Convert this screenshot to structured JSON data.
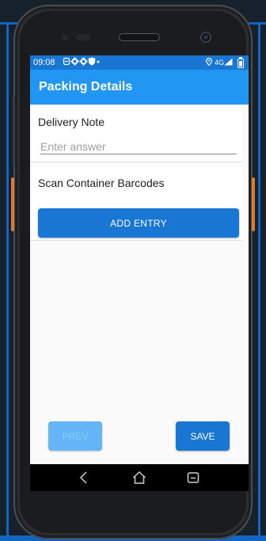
{
  "status_bar": {
    "time": "09:08",
    "left_icons": [
      "sync-icon",
      "gear-icon",
      "gear-icon",
      "shield-icon",
      "dot-icon"
    ],
    "network": "4G",
    "right_icons": [
      "location-icon",
      "signal-icon",
      "battery-icon"
    ]
  },
  "app_bar": {
    "title": "Packing Details"
  },
  "form": {
    "delivery_note": {
      "label": "Delivery Note",
      "placeholder": "Enter answer",
      "value": ""
    },
    "scan_barcodes": {
      "label": "Scan Container Barcodes",
      "add_entry_label": "ADD ENTRY"
    }
  },
  "footer": {
    "prev_label": "PREV",
    "save_label": "SAVE",
    "prev_enabled": false
  },
  "colors": {
    "status_bar": "#1976d2",
    "app_bar": "#2196f3",
    "primary_button": "#1976d2",
    "disabled_button": "#64b5f6",
    "screen_background": "#fafafa"
  },
  "nav_bar": {
    "icons": [
      "back-icon",
      "home-icon",
      "recents-icon"
    ]
  }
}
